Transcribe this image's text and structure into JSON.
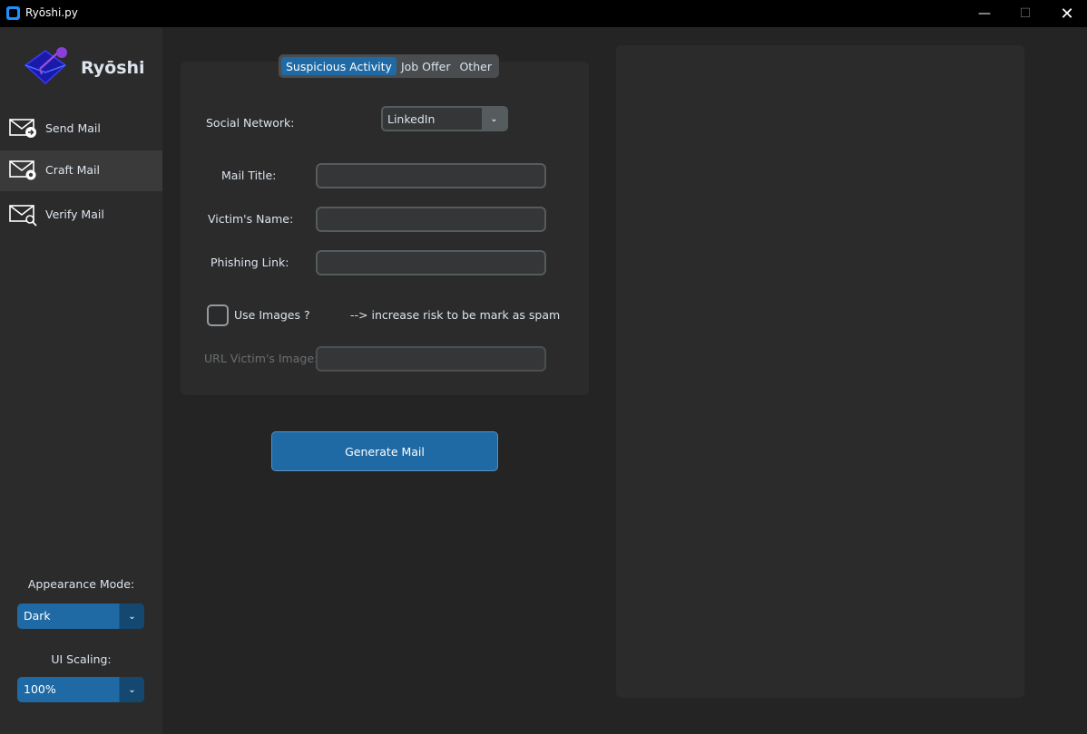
{
  "window": {
    "title": "Ryōshi.py",
    "minimize": "—",
    "maximize": "☐",
    "close": "✕"
  },
  "sidebar": {
    "brand": "Ryōshi",
    "items": [
      {
        "label": "Send Mail",
        "icon": "send-mail-icon"
      },
      {
        "label": "Craft Mail",
        "icon": "craft-mail-icon",
        "active": true
      },
      {
        "label": "Verify Mail",
        "icon": "verify-mail-icon"
      }
    ],
    "appearance_label": "Appearance Mode:",
    "appearance_value": "Dark",
    "scaling_label": "UI Scaling:",
    "scaling_value": "100%"
  },
  "form": {
    "tabs": [
      "Suspicious Activity",
      "Job Offer",
      "Other"
    ],
    "selected_tab": "Suspicious Activity",
    "social_network_label": "Social Network:",
    "social_network_value": "LinkedIn",
    "mail_title_label": "Mail Title:",
    "mail_title_value": "",
    "victim_name_label": "Victim's Name:",
    "victim_name_value": "",
    "phishing_link_label": "Phishing Link:",
    "phishing_link_value": "",
    "use_images_label": "Use Images ?",
    "use_images_checked": false,
    "spam_warning": "--> increase risk to be mark as spam",
    "url_image_label": "URL Victim's Image:",
    "url_image_value": ""
  },
  "generate_button": "Generate Mail",
  "colors": {
    "accent": "#1f6aa5",
    "accent_dark": "#144870",
    "background": "#242424",
    "panel": "#2b2b2b"
  }
}
